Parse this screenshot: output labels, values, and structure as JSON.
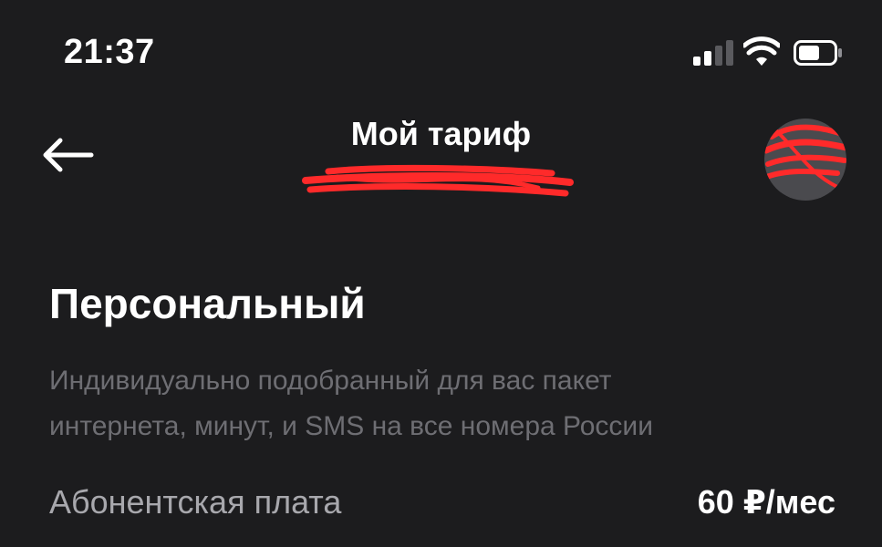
{
  "status_bar": {
    "time": "21:37",
    "signal_icon": "cellular-signal-icon",
    "wifi_icon": "wifi-icon",
    "battery_icon": "battery-icon"
  },
  "nav": {
    "back_icon": "arrow-left-icon",
    "title": "Мой тариф",
    "avatar_icon": "user-avatar"
  },
  "tariff": {
    "name": "Персональный",
    "description_line1": "Индивидуально подобранный для вас пакет",
    "description_line2": "интернета, минут, и SMS на все номера России"
  },
  "fee": {
    "label": "Абонентская плата",
    "value": "60 ₽/мес"
  },
  "colors": {
    "background": "#1c1c1e",
    "text_primary": "#ffffff",
    "text_secondary": "#6e6e73",
    "redaction": "#ff2a2a"
  }
}
